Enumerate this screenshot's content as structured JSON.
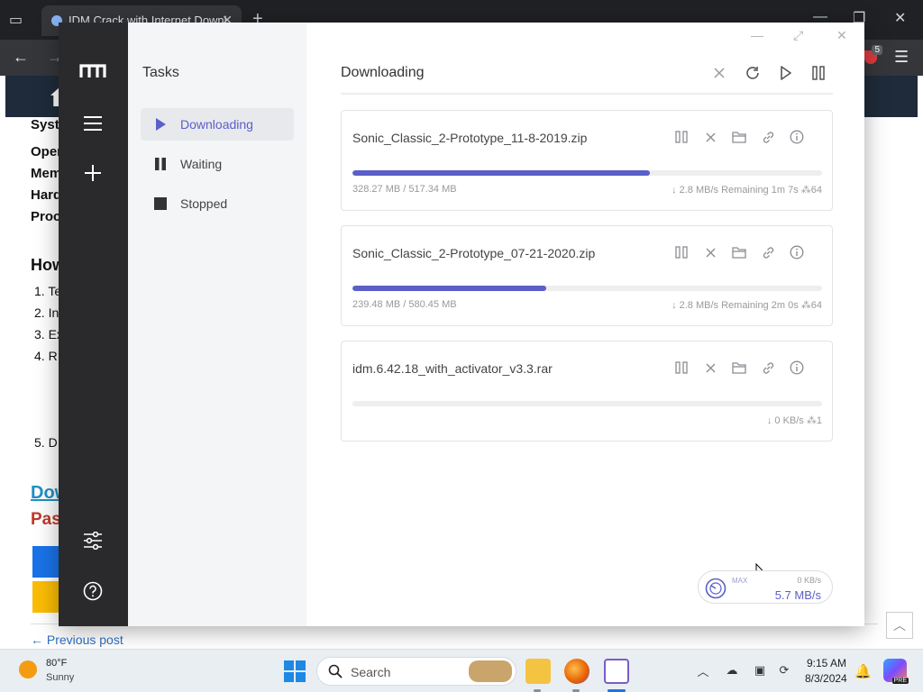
{
  "browser": {
    "tab_title": "IDM Crack with Internet Downl",
    "new_tab": "+",
    "extension_badge": "5"
  },
  "page": {
    "lines_bold": [
      "Syst",
      "Oper",
      "Mem",
      "Hard",
      "Proc"
    ],
    "how_heading": "How",
    "list_items": [
      "1. Te",
      "2. In",
      "3. Ex",
      "4. R",
      "5. D"
    ],
    "download_link": "Dow",
    "password_label": "Pas",
    "previous_post": "← Previous post"
  },
  "app": {
    "sidebar_title": "Tasks",
    "sidebar_items": [
      {
        "label": "Downloading",
        "active": true
      },
      {
        "label": "Waiting",
        "active": false
      },
      {
        "label": "Stopped",
        "active": false
      }
    ],
    "main_title": "Downloading",
    "tasks": [
      {
        "name": "Sonic_Classic_2-Prototype_11-8-2019.zip",
        "size": "328.27 MB / 517.34 MB",
        "speed": "↓ 2.8 MB/s",
        "remaining": "Remaining 1m 7s",
        "connections": "64",
        "progress": 0.634
      },
      {
        "name": "Sonic_Classic_2-Prototype_07-21-2020.zip",
        "size": "239.48 MB / 580.45 MB",
        "speed": "↓ 2.8 MB/s",
        "remaining": "Remaining 2m 0s",
        "connections": "64",
        "progress": 0.413
      },
      {
        "name": "idm.6.42.18_with_activator_v3.3.rar",
        "size": "",
        "speed": "↓ 0 KB/s",
        "remaining": "",
        "connections": "1",
        "progress": 0
      }
    ],
    "speedometer": {
      "max_label": "MAX",
      "upload": "0 KB/s",
      "download": "5.7 MB/s"
    }
  },
  "taskbar": {
    "weather_temp": "80°F",
    "weather_condition": "Sunny",
    "search_placeholder": "Search",
    "clock_time": "9:15 AM",
    "clock_date": "8/3/2024",
    "copilot_badge": "PRE"
  },
  "colors": {
    "accent": "#5b5fc7",
    "rail": "#2a2a2c",
    "sidebar": "#f4f5f7"
  }
}
